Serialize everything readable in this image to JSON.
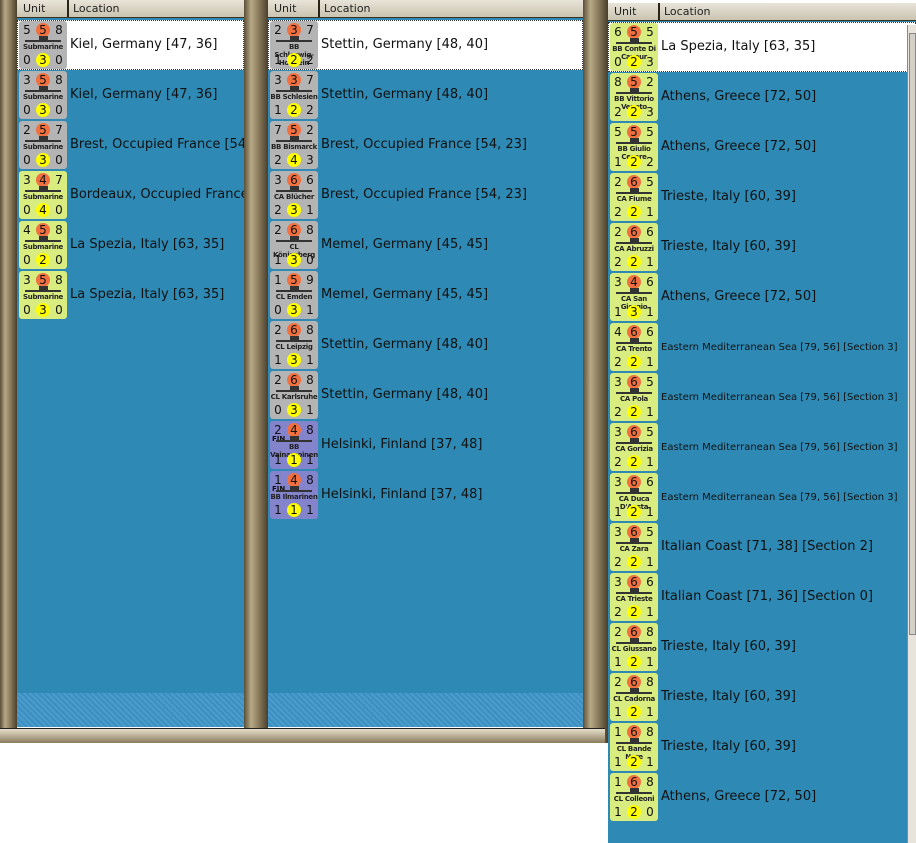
{
  "columns": {
    "unit": "Unit",
    "location": "Location"
  },
  "colors": {
    "list_bg": "#2e8ab4",
    "german": "#b4b4b4",
    "italian": "#d8ec80",
    "finnish": "#8484cc",
    "attack_circle": "#f07040",
    "move_circle": "#ffff00"
  },
  "panels": [
    {
      "rows": [
        {
          "u": {
            "tl": "5",
            "tc": "5",
            "tr": "8",
            "bl": "0",
            "bc": "3",
            "br": "0",
            "name": "Submarine",
            "nation": "german"
          },
          "location": "Kiel, Germany [47, 36]",
          "selected": true
        },
        {
          "u": {
            "tl": "3",
            "tc": "5",
            "tr": "8",
            "bl": "0",
            "bc": "3",
            "br": "0",
            "name": "Submarine",
            "nation": "german"
          },
          "location": "Kiel, Germany [47, 36]"
        },
        {
          "u": {
            "tl": "2",
            "tc": "5",
            "tr": "7",
            "bl": "0",
            "bc": "3",
            "br": "0",
            "name": "Submarine",
            "nation": "german"
          },
          "location": "Brest, Occupied France [54, 23]"
        },
        {
          "u": {
            "tl": "3",
            "tc": "4",
            "tr": "7",
            "bl": "0",
            "bc": "4",
            "br": "0",
            "name": "Submarine",
            "nation": "italian"
          },
          "location": "Bordeaux, Occupied France"
        },
        {
          "u": {
            "tl": "4",
            "tc": "5",
            "tr": "8",
            "bl": "0",
            "bc": "2",
            "br": "0",
            "name": "Submarine",
            "nation": "italian"
          },
          "location": "La Spezia, Italy [63, 35]"
        },
        {
          "u": {
            "tl": "3",
            "tc": "5",
            "tr": "8",
            "bl": "0",
            "bc": "3",
            "br": "0",
            "name": "Submarine",
            "nation": "italian"
          },
          "location": "La Spezia, Italy [63, 35]"
        }
      ]
    },
    {
      "rows": [
        {
          "u": {
            "tl": "2",
            "tc": "3",
            "tr": "7",
            "bl": "1",
            "bc": "2",
            "br": "2",
            "name": "BB Schleswig-Holstein",
            "nation": "german"
          },
          "location": "Stettin, Germany [48, 40]",
          "selected": true
        },
        {
          "u": {
            "tl": "3",
            "tc": "3",
            "tr": "7",
            "bl": "1",
            "bc": "2",
            "br": "2",
            "name": "BB Schlesien",
            "nation": "german"
          },
          "location": "Stettin, Germany [48, 40]"
        },
        {
          "u": {
            "tl": "7",
            "tc": "5",
            "tr": "2",
            "bl": "2",
            "bc": "4",
            "br": "3",
            "name": "BB Bismarck",
            "nation": "german"
          },
          "location": "Brest, Occupied France [54, 23]"
        },
        {
          "u": {
            "tl": "3",
            "tc": "6",
            "tr": "6",
            "bl": "2",
            "bc": "3",
            "br": "1",
            "name": "CA Blücher",
            "nation": "german"
          },
          "location": "Brest, Occupied France [54, 23]"
        },
        {
          "u": {
            "tl": "2",
            "tc": "6",
            "tr": "8",
            "bl": "1",
            "bc": "3",
            "br": "0",
            "name": "CL Königsberg",
            "nation": "german"
          },
          "location": "Memel, Germany [45, 45]"
        },
        {
          "u": {
            "tl": "1",
            "tc": "5",
            "tr": "9",
            "bl": "0",
            "bc": "3",
            "br": "1",
            "name": "CL Emden",
            "nation": "german"
          },
          "location": "Memel, Germany [45, 45]"
        },
        {
          "u": {
            "tl": "2",
            "tc": "6",
            "tr": "8",
            "bl": "1",
            "bc": "3",
            "br": "1",
            "name": "CL Leipzig",
            "nation": "german"
          },
          "location": "Stettin, Germany [48, 40]"
        },
        {
          "u": {
            "tl": "2",
            "tc": "6",
            "tr": "8",
            "bl": "0",
            "bc": "3",
            "br": "1",
            "name": "CL Karlsruhe",
            "nation": "german"
          },
          "location": "Stettin, Germany [48, 40]"
        },
        {
          "u": {
            "tl": "2",
            "tc": "4",
            "tr": "8",
            "bl": "1",
            "bc": "1",
            "br": "1",
            "name": "BB Vainamoinen",
            "nation": "finnish",
            "flag": "FIN"
          },
          "location": "Helsinki, Finland [37, 48]"
        },
        {
          "u": {
            "tl": "1",
            "tc": "4",
            "tr": "8",
            "bl": "1",
            "bc": "1",
            "br": "1",
            "name": "BB Ilmarinen",
            "nation": "finnish",
            "flag": "FIN"
          },
          "location": "Helsinki, Finland [37, 48]"
        }
      ]
    },
    {
      "rows": [
        {
          "u": {
            "tl": "6",
            "tc": "5",
            "tr": "5",
            "bl": "0",
            "bc": "2",
            "br": "3",
            "name": "BB Conte Di Cavour",
            "nation": "italian"
          },
          "location": "La Spezia, Italy [63, 35]",
          "selected": true
        },
        {
          "u": {
            "tl": "8",
            "tc": "5",
            "tr": "2",
            "bl": "2",
            "bc": "2",
            "br": "3",
            "name": "BB Vittorio Veneto",
            "nation": "italian"
          },
          "location": "Athens, Greece [72, 50]"
        },
        {
          "u": {
            "tl": "5",
            "tc": "5",
            "tr": "5",
            "bl": "1",
            "bc": "2",
            "br": "2",
            "name": "BB Giulio Cesare",
            "nation": "italian"
          },
          "location": "Athens, Greece [72, 50]"
        },
        {
          "u": {
            "tl": "2",
            "tc": "6",
            "tr": "5",
            "bl": "2",
            "bc": "2",
            "br": "1",
            "name": "CA Fiume",
            "nation": "italian"
          },
          "location": "Trieste, Italy [60, 39]"
        },
        {
          "u": {
            "tl": "2",
            "tc": "6",
            "tr": "6",
            "bl": "2",
            "bc": "2",
            "br": "1",
            "name": "CA Abruzzi",
            "nation": "italian"
          },
          "location": "Trieste, Italy [60, 39]"
        },
        {
          "u": {
            "tl": "3",
            "tc": "4",
            "tr": "6",
            "bl": "1",
            "bc": "3",
            "br": "1",
            "name": "CA San Giorgio",
            "nation": "italian"
          },
          "location": "Athens, Greece [72, 50]"
        },
        {
          "u": {
            "tl": "4",
            "tc": "6",
            "tr": "6",
            "bl": "2",
            "bc": "2",
            "br": "1",
            "name": "CA Trento",
            "nation": "italian"
          },
          "location": "Eastern Mediterranean Sea [79, 56] [Section 3]",
          "small": true
        },
        {
          "u": {
            "tl": "3",
            "tc": "6",
            "tr": "5",
            "bl": "2",
            "bc": "2",
            "br": "1",
            "name": "CA Pola",
            "nation": "italian"
          },
          "location": "Eastern Mediterranean Sea [79, 56] [Section 3]",
          "small": true
        },
        {
          "u": {
            "tl": "3",
            "tc": "6",
            "tr": "5",
            "bl": "2",
            "bc": "2",
            "br": "1",
            "name": "CA Gorizia",
            "nation": "italian"
          },
          "location": "Eastern Mediterranean Sea [79, 56] [Section 3]",
          "small": true
        },
        {
          "u": {
            "tl": "3",
            "tc": "6",
            "tr": "6",
            "bl": "1",
            "bc": "2",
            "br": "1",
            "name": "CA Duca D'Aosta",
            "nation": "italian"
          },
          "location": "Eastern Mediterranean Sea [79, 56] [Section 3]",
          "small": true
        },
        {
          "u": {
            "tl": "3",
            "tc": "6",
            "tr": "5",
            "bl": "2",
            "bc": "2",
            "br": "1",
            "name": "CA Zara",
            "nation": "italian"
          },
          "location": "Italian Coast [71, 38] [Section 2]"
        },
        {
          "u": {
            "tl": "3",
            "tc": "6",
            "tr": "6",
            "bl": "2",
            "bc": "2",
            "br": "1",
            "name": "CA Trieste",
            "nation": "italian"
          },
          "location": "Italian Coast [71, 36] [Section 0]"
        },
        {
          "u": {
            "tl": "2",
            "tc": "6",
            "tr": "8",
            "bl": "1",
            "bc": "2",
            "br": "1",
            "name": "CL Giussano",
            "nation": "italian"
          },
          "location": "Trieste, Italy [60, 39]"
        },
        {
          "u": {
            "tl": "2",
            "tc": "6",
            "tr": "8",
            "bl": "1",
            "bc": "2",
            "br": "1",
            "name": "CL Cadorna",
            "nation": "italian"
          },
          "location": "Trieste, Italy [60, 39]"
        },
        {
          "u": {
            "tl": "1",
            "tc": "6",
            "tr": "8",
            "bl": "1",
            "bc": "2",
            "br": "1",
            "name": "CL Bande Nere",
            "nation": "italian"
          },
          "location": "Trieste, Italy [60, 39]"
        },
        {
          "u": {
            "tl": "1",
            "tc": "6",
            "tr": "8",
            "bl": "1",
            "bc": "2",
            "br": "0",
            "name": "CL Colleoni",
            "nation": "italian"
          },
          "location": "Athens, Greece [72, 50]"
        }
      ]
    }
  ]
}
